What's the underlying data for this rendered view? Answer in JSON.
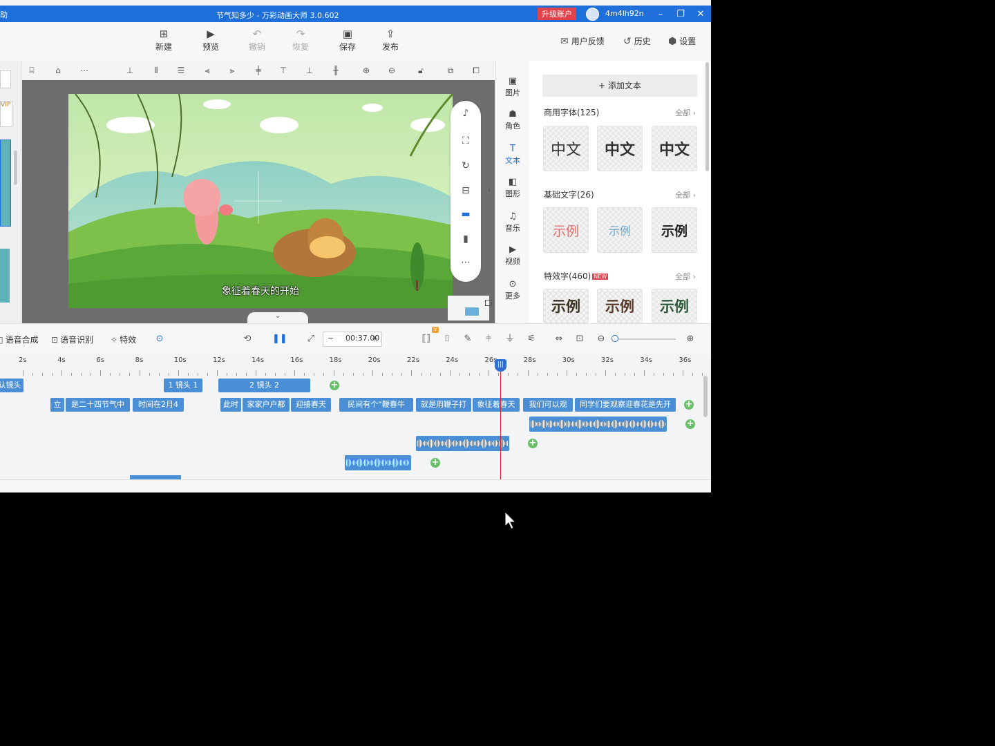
{
  "titlebar": {
    "left_fragment": "助",
    "title": "节气知多少 - 万彩动画大师 3.0.602",
    "upgrade_label": "升级账户",
    "username": "4m4lh92n"
  },
  "toolbar": {
    "new_label": "新建",
    "preview_label": "预览",
    "undo_label": "撤销",
    "redo_label": "恢复",
    "save_label": "保存",
    "publish_label": "发布",
    "feedback_label": "用户反馈",
    "history_label": "历史",
    "settings_label": "设置"
  },
  "left_strip": {
    "vip_label": "VIP"
  },
  "canvas": {
    "subtitle": "象征着春天的开始"
  },
  "categories": [
    {
      "label": "图片",
      "icon": "image-icon"
    },
    {
      "label": "角色",
      "icon": "character-icon"
    },
    {
      "label": "文本",
      "icon": "text-icon",
      "active": true
    },
    {
      "label": "图形",
      "icon": "shape-icon"
    },
    {
      "label": "音乐",
      "icon": "music-icon"
    },
    {
      "label": "视频",
      "icon": "video-icon"
    },
    {
      "label": "更多",
      "icon": "more-icon"
    }
  ],
  "text_panel": {
    "add_text_label": "添加文本",
    "sections": [
      {
        "title": "商用字体(125)",
        "all": "全部",
        "tiles": [
          "中文",
          "中文",
          "中文"
        ]
      },
      {
        "title": "基础文字(26)",
        "all": "全部",
        "tiles": [
          "示例",
          "示例",
          "示例"
        ]
      },
      {
        "title": "特效字(460)",
        "all": "全部",
        "badge": "NEW",
        "tiles": [
          "示例",
          "示例",
          "示例"
        ]
      }
    ]
  },
  "timeline_toolbar": {
    "tts_label": "语音合成",
    "asr_label": "语音识别",
    "effects_label": "特效",
    "time_value": "00:37.00",
    "vip_badge": "V"
  },
  "ruler_labels": [
    "2s",
    "4s",
    "6s",
    "8s",
    "10s",
    "12s",
    "14s",
    "16s",
    "18s",
    "20s",
    "22s",
    "24s",
    "26s",
    "28s",
    "30s",
    "32s",
    "34s",
    "36s"
  ],
  "tracks": {
    "camera": [
      "认镜头",
      "1 镜头 1",
      "2 镜头 2"
    ],
    "subtitles": [
      "立",
      "是二十四节气中",
      "时间在2月4",
      "此时",
      "家家户户都",
      "迎接春天",
      "民间有个“鞭春牛",
      "就是用鞭子打",
      "象征着春天",
      "我们可以观",
      "同学们要观察迎春花是先开"
    ]
  },
  "colors": {
    "accent": "#1e6fd9",
    "clip": "#4a8fd6",
    "playhead": "#e0202a",
    "add": "#6bbf6a",
    "upgrade": "#e0434b"
  }
}
